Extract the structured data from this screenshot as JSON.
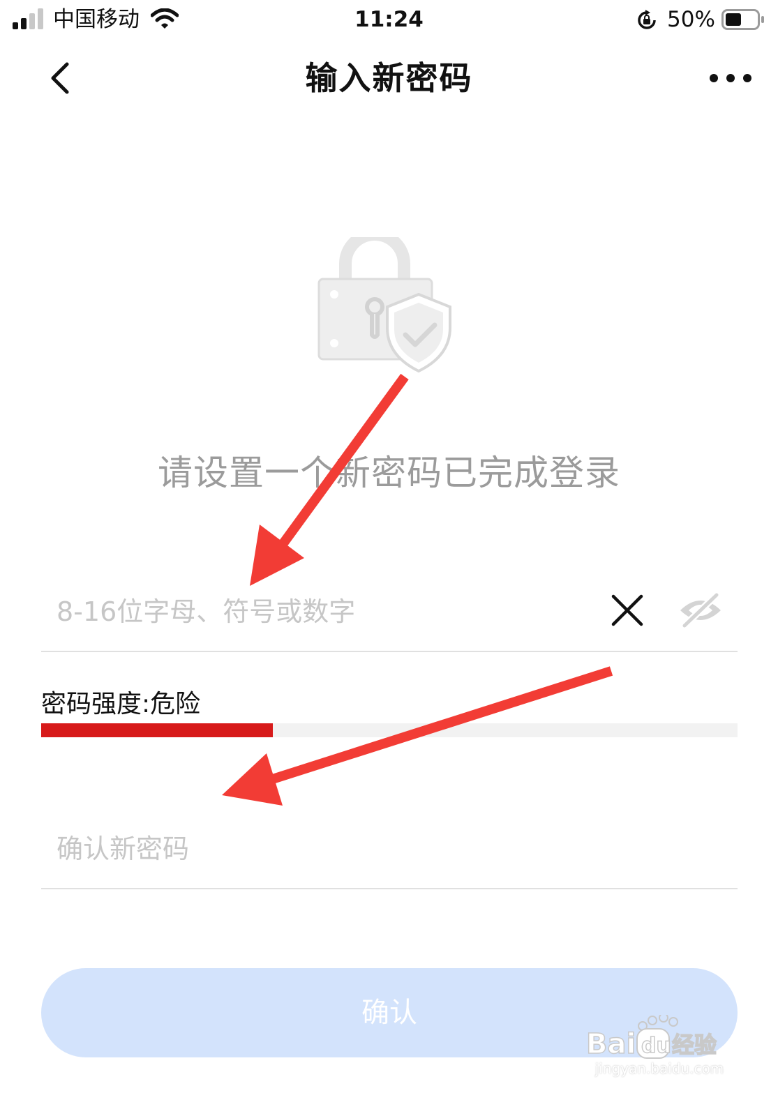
{
  "status_bar": {
    "carrier": "中国移动",
    "time": "11:24",
    "battery_percent": "50%",
    "battery_level": 0.5,
    "icons": [
      "signal-icon",
      "wifi-icon",
      "rotation-lock-icon",
      "battery-icon"
    ]
  },
  "nav": {
    "title": "输入新密码",
    "back_icon": "chevron-left-icon",
    "more_icon": "more-dots-icon"
  },
  "illustration": {
    "icon": "padlock-shield-check-icon"
  },
  "prompt": "请设置一个新密码已完成登录",
  "password_field": {
    "value": "",
    "placeholder": "8-16位字母、符号或数字",
    "clear_icon": "close-icon",
    "visibility_icon": "eye-off-icon"
  },
  "strength": {
    "label": "密码强度:危险",
    "level": 0.333,
    "color": "#d71a1a"
  },
  "confirm_field": {
    "value": "",
    "placeholder": "确认新密码"
  },
  "confirm_button": {
    "label": "确认",
    "color": "#d3e3fc"
  },
  "annotation": {
    "arrow_color": "#f23c35"
  },
  "watermark": {
    "logo_text": "Bai du 经验",
    "url": "jingyan.baidu.com"
  }
}
